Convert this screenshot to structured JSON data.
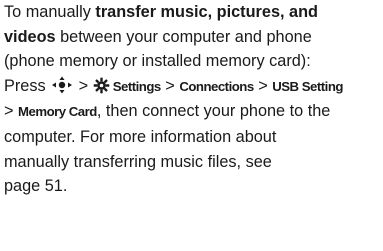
{
  "text": {
    "l1_pre": "To manually ",
    "l1_bold": "transfer music, pictures, and",
    "l2_bold": "videos",
    "l2_post": " between your computer and phone",
    "l3": "(phone memory or installed memory card):",
    "l4_press": "Press ",
    "l4_gt1": " > ",
    "l4_settings": "Settings",
    "l4_gt2": " > ",
    "l4_connections": "Connections",
    "l4_gt3": " > ",
    "l4_usb": "USB Setting",
    "l5_gt": "> ",
    "l5_memory": "Memory Card",
    "l5_post": ", then connect your phone to the",
    "l6": "computer. For more information about",
    "l7": "manually transferring music files, see",
    "l8": "page 51."
  },
  "icons": {
    "nav_key": "navigation-key-icon",
    "settings": "settings-gear-icon"
  }
}
